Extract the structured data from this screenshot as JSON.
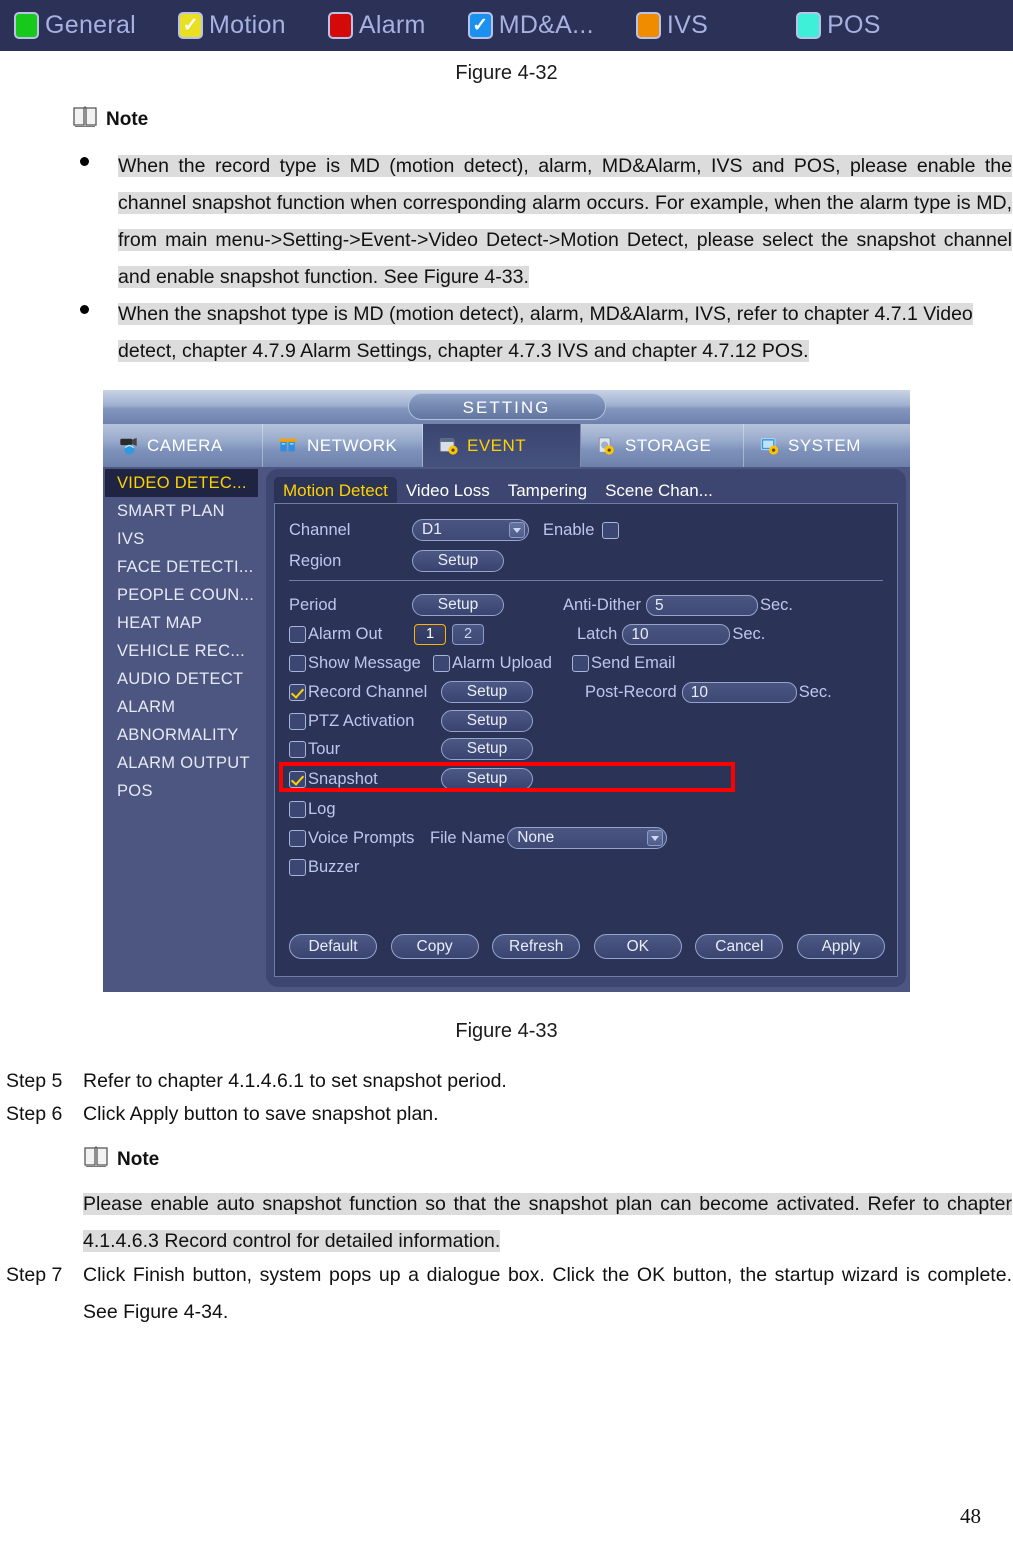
{
  "legend": {
    "items": [
      {
        "label": "General",
        "color": "#16c91a",
        "checked": false,
        "name": "general"
      },
      {
        "label": "Motion",
        "color": "#e8e020",
        "checked": true,
        "name": "motion"
      },
      {
        "label": "Alarm",
        "color": "#d40a0a",
        "checked": false,
        "name": "alarm"
      },
      {
        "label": "MD&A...",
        "color": "#1a90f0",
        "checked": true,
        "name": "md-and-alarm"
      },
      {
        "label": "IVS",
        "color": "#f08c00",
        "checked": false,
        "name": "ivs"
      },
      {
        "label": "POS",
        "color": "#3ff0d8",
        "checked": false,
        "name": "pos"
      }
    ]
  },
  "document": {
    "figure_caption_432": "Figure 4-32",
    "figure_caption_433": "Figure 4-33",
    "note_title": "Note",
    "note1_bullets": [
      "When the record type is MD (motion detect), alarm, MD&Alarm, IVS and POS, please enable the channel snapshot function when corresponding alarm occurs. For example, when the alarm type is MD, from main menu->Setting->Event->Video Detect->Motion Detect, please select the snapshot channel and enable snapshot function. See Figure 4-33.",
      "When the snapshot type is MD (motion detect), alarm, MD&Alarm, IVS, refer to chapter 4.7.1 Video detect, chapter 4.7.9 Alarm Settings, chapter 4.7.3 IVS and chapter 4.7.12 POS. "
    ],
    "step5_label": "Step 5",
    "step5_text": "Refer to chapter 4.1.4.6.1 to set snapshot period.",
    "step6_label": "Step 6",
    "step6_text": "Click Apply button to save snapshot plan.",
    "note2_title": "Note",
    "note2_text": "Please enable auto snapshot function so that the snapshot plan can become activated. Refer to chapter 4.1.4.6.3 Record control for detailed information. ",
    "step7_label": "Step 7",
    "step7_text": "Click Finish button, system pops up a dialogue box. Click the OK button, the startup wizard is complete. See Figure 4-34.",
    "page_number": "48"
  },
  "nvr": {
    "title": "SETTING",
    "top_tabs": [
      {
        "label": "CAMERA",
        "icon": "camera-icon",
        "active": false
      },
      {
        "label": "NETWORK",
        "icon": "network-icon",
        "active": false
      },
      {
        "label": "EVENT",
        "icon": "event-icon",
        "active": true
      },
      {
        "label": "STORAGE",
        "icon": "storage-icon",
        "active": false
      },
      {
        "label": "SYSTEM",
        "icon": "system-icon",
        "active": false
      }
    ],
    "sidebar": [
      {
        "label": "VIDEO DETEC...",
        "active": true
      },
      {
        "label": "SMART PLAN",
        "active": false
      },
      {
        "label": "IVS",
        "active": false
      },
      {
        "label": "FACE DETECTI...",
        "active": false
      },
      {
        "label": "PEOPLE COUN...",
        "active": false
      },
      {
        "label": "HEAT MAP",
        "active": false
      },
      {
        "label": "VEHICLE REC...",
        "active": false
      },
      {
        "label": "AUDIO DETECT",
        "active": false
      },
      {
        "label": "ALARM",
        "active": false
      },
      {
        "label": "ABNORMALITY",
        "active": false
      },
      {
        "label": "ALARM OUTPUT",
        "active": false
      },
      {
        "label": "POS",
        "active": false
      }
    ],
    "panel_tabs": [
      {
        "label": "Motion Detect",
        "active": true
      },
      {
        "label": "Video Loss",
        "active": false
      },
      {
        "label": "Tampering",
        "active": false
      },
      {
        "label": "Scene Chan...",
        "active": false
      }
    ],
    "form": {
      "channel_label": "Channel",
      "channel_value": "D1",
      "enable_label": "Enable",
      "enable_checked": false,
      "region_label": "Region",
      "region_button": "Setup",
      "period_label": "Period",
      "period_button": "Setup",
      "antidither_label": "Anti-Dither",
      "antidither_value": "5",
      "antidither_suffix": "Sec.",
      "alarmout_label": "Alarm Out",
      "alarmout_checked": false,
      "alarmout_port1": "1",
      "alarmout_port2": "2",
      "latch_label": "Latch",
      "latch_value": "10",
      "latch_suffix": "Sec.",
      "showmessage_label": "Show Message",
      "showmessage_checked": false,
      "alarmupload_label": "Alarm Upload",
      "alarmupload_checked": false,
      "sendemail_label": "Send Email",
      "sendemail_checked": false,
      "recordchannel_label": "Record Channel",
      "recordchannel_checked": true,
      "recordchannel_button": "Setup",
      "postrecord_label": "Post-Record",
      "postrecord_value": "10",
      "postrecord_suffix": "Sec.",
      "ptz_label": "PTZ Activation",
      "ptz_checked": false,
      "ptz_button": "Setup",
      "tour_label": "Tour",
      "tour_checked": false,
      "tour_button": "Setup",
      "snapshot_label": "Snapshot",
      "snapshot_checked": true,
      "snapshot_button": "Setup",
      "log_label": "Log",
      "log_checked": false,
      "voiceprompts_label": "Voice Prompts",
      "voiceprompts_checked": false,
      "filename_label": "File Name",
      "filename_value": "None",
      "buzzer_label": "Buzzer",
      "buzzer_checked": false
    },
    "buttons": {
      "default": "Default",
      "copy": "Copy",
      "refresh": "Refresh",
      "ok": "OK",
      "cancel": "Cancel",
      "apply": "Apply"
    },
    "highlight_color": "#ff0000"
  }
}
